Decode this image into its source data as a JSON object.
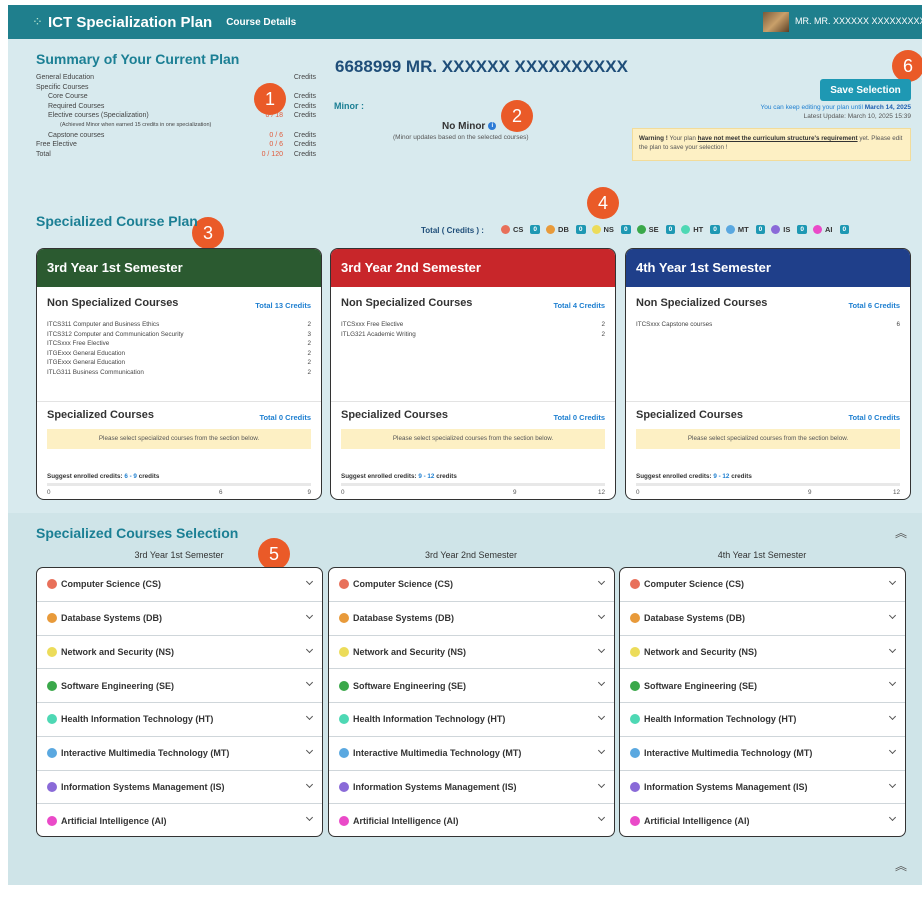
{
  "header": {
    "title": "ICT Specialization Plan",
    "breadcrumb": "Course Details",
    "user": "MR. MR. XXXXXX XXXXXXXXXX"
  },
  "summary": {
    "title": "Summary of Your Current Plan",
    "rows": [
      {
        "label": "General Education",
        "value": "",
        "unit": "Credits"
      },
      {
        "label": "Specific Courses",
        "value": "",
        "unit": ""
      },
      {
        "label": "Core Course",
        "value": "0 / 12",
        "unit": "Credits"
      },
      {
        "label": "Required Courses",
        "value": "0 / 48",
        "unit": "Credits"
      },
      {
        "label": "Elective courses (Specialization)",
        "value": "0 / 18",
        "unit": "Credits"
      },
      {
        "label": "(Achieved Minor when earned 15 credits in one specialization)",
        "value": "",
        "unit": ""
      },
      {
        "label": "Capstone courses",
        "value": "0 / 6",
        "unit": "Credits"
      },
      {
        "label": "Free Elective",
        "value": "0 / 6",
        "unit": "Credits"
      },
      {
        "label": "Total",
        "value": "0 / 120",
        "unit": "Credits"
      }
    ]
  },
  "badges": [
    "1",
    "2",
    "3",
    "4",
    "5",
    "6"
  ],
  "student": {
    "title": "6688999 MR. XXXXXX XXXXXXXXXX"
  },
  "minor": {
    "label": "Minor :",
    "value": "No Minor",
    "note": "(Minor updates based on the selected courses)"
  },
  "actions": {
    "save": "Save Selection",
    "edit_until_prefix": "You can keep editing your plan until",
    "edit_until_date": "March 14, 2025",
    "last_update": "Latest Update: March 10, 2025 15:39"
  },
  "warning": {
    "strong": "Warning !",
    "text1": "Your plan",
    "link": "have not meet the curriculum structure's requirement",
    "text2": "yet. Please edit the plan to save your selection !"
  },
  "plan": {
    "title": "Specialized Course Plan",
    "total_label": "Total ( Credits ) :",
    "totals": [
      {
        "code": "CS",
        "count": "0",
        "color": "#e8705a"
      },
      {
        "code": "DB",
        "count": "0",
        "color": "#e89a3a"
      },
      {
        "code": "NS",
        "count": "0",
        "color": "#ecdc5a"
      },
      {
        "code": "SE",
        "count": "0",
        "color": "#3aa84a"
      },
      {
        "code": "HT",
        "count": "0",
        "color": "#4ed8b4"
      },
      {
        "code": "MT",
        "count": "0",
        "color": "#5aa8e0"
      },
      {
        "code": "IS",
        "count": "0",
        "color": "#8a6ad8"
      },
      {
        "code": "AI",
        "count": "0",
        "color": "#ea4ac8"
      }
    ]
  },
  "semesters": [
    {
      "title": "3rd Year 1st Semester",
      "color": "#2b5a30",
      "non_spec_title": "Non Specialized Courses",
      "non_spec_total": "Total 13 Credits",
      "courses": [
        {
          "name": "ITCS311  Computer and Business Ethics",
          "credits": "2"
        },
        {
          "name": "ITCS312  Computer and Communication Security",
          "credits": "3"
        },
        {
          "name": "ITCSxxx  Free Elective",
          "credits": "2"
        },
        {
          "name": "ITGExxx  General Education",
          "credits": "2"
        },
        {
          "name": "ITGExxx  General Education",
          "credits": "2"
        },
        {
          "name": "ITLG311  Business Communication",
          "credits": "2"
        }
      ],
      "spec_title": "Specialized Courses",
      "spec_total": "Total 0 Credits",
      "notice": "Please select specialized courses from the section below.",
      "suggest_label": "Suggest enrolled credits:",
      "suggest_value": "6 - 9",
      "suggest_unit": "credits",
      "scale": [
        "0",
        "6",
        "9"
      ]
    },
    {
      "title": "3rd Year 2nd Semester",
      "color": "#c8262a",
      "non_spec_title": "Non Specialized Courses",
      "non_spec_total": "Total 4 Credits",
      "courses": [
        {
          "name": "ITCSxxx  Free Elective",
          "credits": "2"
        },
        {
          "name": "ITLG321  Academic Writing",
          "credits": "2"
        }
      ],
      "spec_title": "Specialized Courses",
      "spec_total": "Total 0 Credits",
      "notice": "Please select specialized courses from the section below.",
      "suggest_label": "Suggest enrolled credits:",
      "suggest_value": "9 - 12",
      "suggest_unit": "credits",
      "scale": [
        "0",
        "9",
        "12"
      ]
    },
    {
      "title": "4th Year 1st Semester",
      "color": "#1f3f8a",
      "non_spec_title": "Non Specialized Courses",
      "non_spec_total": "Total 6 Credits",
      "courses": [
        {
          "name": "ITCSxxx  Capstone courses",
          "credits": "6"
        }
      ],
      "spec_title": "Specialized Courses",
      "spec_total": "Total 0 Credits",
      "notice": "Please select specialized courses from the section below.",
      "suggest_label": "Suggest enrolled credits:",
      "suggest_value": "9 - 12",
      "suggest_unit": "credits",
      "scale": [
        "0",
        "9",
        "12"
      ]
    }
  ],
  "selection": {
    "title": "Specialized Courses Selection",
    "columns": [
      "3rd Year 1st Semester",
      "3rd Year 2nd Semester",
      "4th Year 1st Semester"
    ],
    "specializations": [
      {
        "label": "Computer Science (CS)",
        "color": "#e8705a"
      },
      {
        "label": "Database Systems (DB)",
        "color": "#e89a3a"
      },
      {
        "label": "Network and Security (NS)",
        "color": "#ecdc5a"
      },
      {
        "label": "Software Engineering (SE)",
        "color": "#3aa84a"
      },
      {
        "label": "Health Information Technology (HT)",
        "color": "#4ed8b4"
      },
      {
        "label": "Interactive Multimedia Technology (MT)",
        "color": "#5aa8e0"
      },
      {
        "label": "Information Systems Management (IS)",
        "color": "#8a6ad8"
      },
      {
        "label": "Artificial Intelligence (AI)",
        "color": "#ea4ac8"
      }
    ],
    "collapse_icon": "double-chevron-up-icon"
  }
}
